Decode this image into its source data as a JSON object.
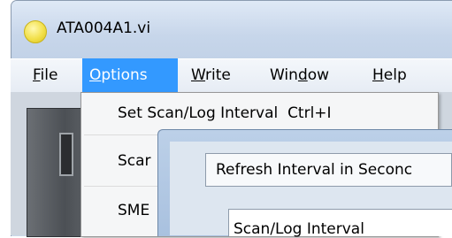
{
  "window": {
    "title": "ATA004A1.vi"
  },
  "menubar": {
    "items": [
      {
        "label_pre": "",
        "mnemonic": "F",
        "label_post": "ile"
      },
      {
        "label_pre": "",
        "mnemonic": "O",
        "label_post": "ptions"
      },
      {
        "label_pre": "",
        "mnemonic": "W",
        "label_post": "rite"
      },
      {
        "label_pre": "Win",
        "mnemonic": "d",
        "label_post": "ow"
      },
      {
        "label_pre": "",
        "mnemonic": "H",
        "label_post": "elp"
      }
    ],
    "active_item": "Options"
  },
  "options_menu": {
    "items": [
      {
        "label": "Set Scan/Log Interval",
        "shortcut": "Ctrl+I"
      },
      {
        "label": "Scar"
      },
      {
        "label": "SME"
      }
    ]
  },
  "dialog": {
    "refresh_label": "Refresh Interval in Seconc",
    "scan_log_label": "Scan/Log Interval"
  },
  "colors": {
    "menu_highlight": "#3399ff",
    "window_frame": "#cbd9ea",
    "app_icon": "#f2e04a"
  },
  "icons": {
    "app": "yellow-circle-icon"
  }
}
